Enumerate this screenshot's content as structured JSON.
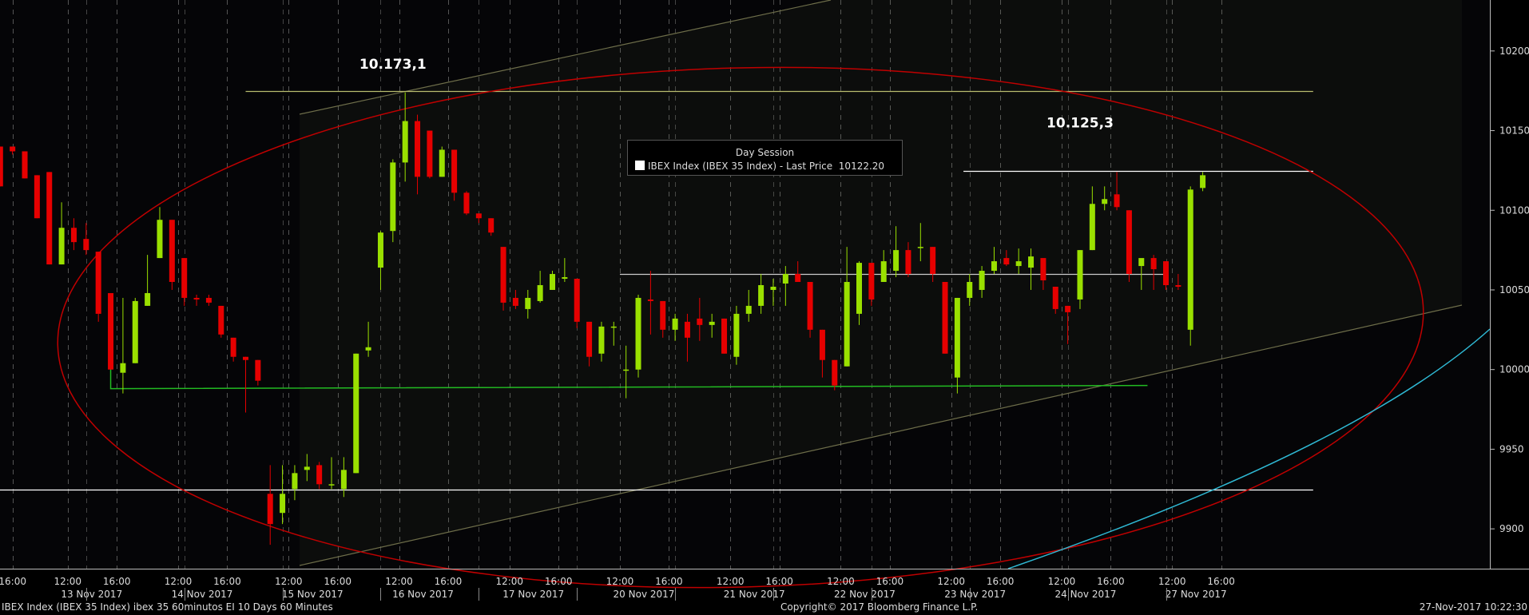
{
  "chart_data": {
    "type": "candlestick",
    "title": "IBEX Index (IBEX 35 Index) ibex 35 60minutos EI 10 Days 60 Minutes",
    "legend": {
      "title": "Day Session",
      "entry": "IBEX Index (IBEX 35 Index) - Last Price",
      "value": "10122.20"
    },
    "y_ticks": [
      9900,
      9950,
      10000,
      10050,
      10100,
      10150,
      10200
    ],
    "ylim": [
      9875,
      10232
    ],
    "candles": [
      {
        "o": 10140,
        "h": 10140,
        "l": 10115,
        "c": 10115
      },
      {
        "o": 10140,
        "h": 10140,
        "l": 10135,
        "c": 10137
      },
      {
        "o": 10137,
        "h": 10137,
        "l": 10120,
        "c": 10120
      },
      {
        "o": 10122,
        "h": 10122,
        "l": 10095,
        "c": 10095
      },
      {
        "o": 10124,
        "h": 10124,
        "l": 10066,
        "c": 10066
      },
      {
        "o": 10066,
        "h": 10105,
        "l": 10066,
        "c": 10089
      },
      {
        "o": 10089,
        "h": 10095,
        "l": 10075,
        "c": 10080
      },
      {
        "o": 10082,
        "h": 10092,
        "l": 10072,
        "c": 10075
      },
      {
        "o": 10074,
        "h": 10074,
        "l": 10030,
        "c": 10035
      },
      {
        "o": 10048,
        "h": 10048,
        "l": 10000,
        "c": 10000
      },
      {
        "o": 9998,
        "h": 10045,
        "l": 9985,
        "c": 10004
      },
      {
        "o": 10004,
        "h": 10045,
        "l": 10004,
        "c": 10043
      },
      {
        "o": 10040,
        "h": 10072,
        "l": 10040,
        "c": 10048
      },
      {
        "o": 10070,
        "h": 10102,
        "l": 10070,
        "c": 10094
      },
      {
        "o": 10094,
        "h": 10094,
        "l": 10050,
        "c": 10055
      },
      {
        "o": 10070,
        "h": 10070,
        "l": 10040,
        "c": 10045
      },
      {
        "o": 10045,
        "h": 10047,
        "l": 10040,
        "c": 10044
      },
      {
        "o": 10045,
        "h": 10047,
        "l": 10040,
        "c": 10042
      },
      {
        "o": 10040,
        "h": 10040,
        "l": 10020,
        "c": 10022
      },
      {
        "o": 10020,
        "h": 10020,
        "l": 10005,
        "c": 10008
      },
      {
        "o": 10008,
        "h": 10008,
        "l": 9973,
        "c": 10006
      },
      {
        "o": 10006,
        "h": 10006,
        "l": 9990,
        "c": 9993
      },
      {
        "o": 9922,
        "h": 9940,
        "l": 9890,
        "c": 9903
      },
      {
        "o": 9910,
        "h": 9940,
        "l": 9903,
        "c": 9922
      },
      {
        "o": 9925,
        "h": 9940,
        "l": 9918,
        "c": 9935
      },
      {
        "o": 9937,
        "h": 9947,
        "l": 9930,
        "c": 9939
      },
      {
        "o": 9940,
        "h": 9942,
        "l": 9925,
        "c": 9928
      },
      {
        "o": 9928,
        "h": 9945,
        "l": 9925,
        "c": 9928
      },
      {
        "o": 9925,
        "h": 9945,
        "l": 9920,
        "c": 9937
      },
      {
        "o": 9935,
        "h": 10010,
        "l": 9935,
        "c": 10010
      },
      {
        "o": 10012,
        "h": 10030,
        "l": 10008,
        "c": 10014
      },
      {
        "o": 10064,
        "h": 10087,
        "l": 10050,
        "c": 10086
      },
      {
        "o": 10087,
        "h": 10132,
        "l": 10080,
        "c": 10130
      },
      {
        "o": 10130,
        "h": 10174,
        "l": 10118,
        "c": 10156
      },
      {
        "o": 10156,
        "h": 10160,
        "l": 10110,
        "c": 10121
      },
      {
        "o": 10150,
        "h": 10150,
        "l": 10120,
        "c": 10121
      },
      {
        "o": 10121,
        "h": 10140,
        "l": 10121,
        "c": 10138
      },
      {
        "o": 10138,
        "h": 10138,
        "l": 10106,
        "c": 10111
      },
      {
        "o": 10111,
        "h": 10112,
        "l": 10097,
        "c": 10098
      },
      {
        "o": 10098,
        "h": 10098,
        "l": 10092,
        "c": 10095
      },
      {
        "o": 10095,
        "h": 10095,
        "l": 10084,
        "c": 10086
      },
      {
        "o": 10077,
        "h": 10077,
        "l": 10037,
        "c": 10042
      },
      {
        "o": 10045,
        "h": 10050,
        "l": 10038,
        "c": 10040
      },
      {
        "o": 10038,
        "h": 10050,
        "l": 10032,
        "c": 10045
      },
      {
        "o": 10043,
        "h": 10062,
        "l": 10042,
        "c": 10053
      },
      {
        "o": 10050,
        "h": 10062,
        "l": 10050,
        "c": 10060
      },
      {
        "o": 10057,
        "h": 10070,
        "l": 10055,
        "c": 10058
      },
      {
        "o": 10057,
        "h": 10057,
        "l": 10026,
        "c": 10030
      },
      {
        "o": 10030,
        "h": 10030,
        "l": 10002,
        "c": 10008
      },
      {
        "o": 10010,
        "h": 10030,
        "l": 10005,
        "c": 10027
      },
      {
        "o": 10027,
        "h": 10030,
        "l": 10015,
        "c": 10027
      },
      {
        "o": 10000,
        "h": 10015,
        "l": 9982,
        "c": 10000
      },
      {
        "o": 10000,
        "h": 10047,
        "l": 9995,
        "c": 10045
      },
      {
        "o": 10044,
        "h": 10062,
        "l": 10022,
        "c": 10043
      },
      {
        "o": 10043,
        "h": 10043,
        "l": 10020,
        "c": 10025
      },
      {
        "o": 10025,
        "h": 10035,
        "l": 10018,
        "c": 10032
      },
      {
        "o": 10030,
        "h": 10035,
        "l": 10005,
        "c": 10020
      },
      {
        "o": 10032,
        "h": 10045,
        "l": 10018,
        "c": 10028
      },
      {
        "o": 10028,
        "h": 10035,
        "l": 10020,
        "c": 10030
      },
      {
        "o": 10032,
        "h": 10032,
        "l": 10010,
        "c": 10010
      },
      {
        "o": 10008,
        "h": 10040,
        "l": 10003,
        "c": 10035
      },
      {
        "o": 10035,
        "h": 10050,
        "l": 10030,
        "c": 10040
      },
      {
        "o": 10040,
        "h": 10060,
        "l": 10035,
        "c": 10053
      },
      {
        "o": 10050,
        "h": 10057,
        "l": 10040,
        "c": 10052
      },
      {
        "o": 10054,
        "h": 10065,
        "l": 10040,
        "c": 10060
      },
      {
        "o": 10060,
        "h": 10068,
        "l": 10055,
        "c": 10055
      },
      {
        "o": 10055,
        "h": 10055,
        "l": 10020,
        "c": 10025
      },
      {
        "o": 10025,
        "h": 10025,
        "l": 9995,
        "c": 10006
      },
      {
        "o": 10006,
        "h": 10006,
        "l": 9987,
        "c": 9990
      },
      {
        "o": 10002,
        "h": 10077,
        "l": 10002,
        "c": 10055
      },
      {
        "o": 10035,
        "h": 10068,
        "l": 10028,
        "c": 10067
      },
      {
        "o": 10067,
        "h": 10067,
        "l": 10040,
        "c": 10044
      },
      {
        "o": 10055,
        "h": 10075,
        "l": 10055,
        "c": 10068
      },
      {
        "o": 10062,
        "h": 10090,
        "l": 10058,
        "c": 10075
      },
      {
        "o": 10075,
        "h": 10080,
        "l": 10058,
        "c": 10060
      },
      {
        "o": 10077,
        "h": 10092,
        "l": 10068,
        "c": 10077
      },
      {
        "o": 10077,
        "h": 10077,
        "l": 10055,
        "c": 10060
      },
      {
        "o": 10055,
        "h": 10055,
        "l": 10010,
        "c": 10010
      },
      {
        "o": 9995,
        "h": 10045,
        "l": 9985,
        "c": 10045
      },
      {
        "o": 10045,
        "h": 10060,
        "l": 10040,
        "c": 10055
      },
      {
        "o": 10050,
        "h": 10065,
        "l": 10045,
        "c": 10062
      },
      {
        "o": 10062,
        "h": 10077,
        "l": 10060,
        "c": 10068
      },
      {
        "o": 10070,
        "h": 10075,
        "l": 10065,
        "c": 10066
      },
      {
        "o": 10065,
        "h": 10076,
        "l": 10060,
        "c": 10068
      },
      {
        "o": 10064,
        "h": 10076,
        "l": 10050,
        "c": 10071
      },
      {
        "o": 10070,
        "h": 10070,
        "l": 10050,
        "c": 10056
      },
      {
        "o": 10052,
        "h": 10052,
        "l": 10035,
        "c": 10038
      },
      {
        "o": 10040,
        "h": 10040,
        "l": 10016,
        "c": 10036
      },
      {
        "o": 10044,
        "h": 10075,
        "l": 10038,
        "c": 10075
      },
      {
        "o": 10075,
        "h": 10115,
        "l": 10075,
        "c": 10104
      },
      {
        "o": 10104,
        "h": 10115,
        "l": 10100,
        "c": 10107
      },
      {
        "o": 10110,
        "h": 10124,
        "l": 10100,
        "c": 10102
      },
      {
        "o": 10100,
        "h": 10100,
        "l": 10055,
        "c": 10060
      },
      {
        "o": 10065,
        "h": 10065,
        "l": 10050,
        "c": 10070
      },
      {
        "o": 10070,
        "h": 10072,
        "l": 10050,
        "c": 10063
      },
      {
        "o": 10068,
        "h": 10068,
        "l": 10050,
        "c": 10053
      },
      {
        "o": 10053,
        "h": 10060,
        "l": 10050,
        "c": 10052
      },
      {
        "o": 10025,
        "h": 10115,
        "l": 10015,
        "c": 10113
      },
      {
        "o": 10114,
        "h": 10124,
        "l": 10112,
        "c": 10122
      }
    ],
    "x_labels": [
      {
        "candle": 1,
        "time": "16:00",
        "date": ""
      },
      {
        "candle": 5.5,
        "time": "12:00",
        "date": "13 Nov 2017"
      },
      {
        "candle": 9.5,
        "time": "16:00",
        "date": ""
      },
      {
        "candle": 14.5,
        "time": "12:00",
        "date": "14 Nov 2017"
      },
      {
        "candle": 18.5,
        "time": "16:00",
        "date": ""
      },
      {
        "candle": 23.5,
        "time": "12:00",
        "date": "15 Nov 2017"
      },
      {
        "candle": 27.5,
        "time": "16:00",
        "date": ""
      },
      {
        "candle": 32.5,
        "time": "12:00",
        "date": "16 Nov 2017"
      },
      {
        "candle": 36.5,
        "time": "16:00",
        "date": ""
      },
      {
        "candle": 41.5,
        "time": "12:00",
        "date": "17 Nov 2017"
      },
      {
        "candle": 45.5,
        "time": "16:00",
        "date": ""
      },
      {
        "candle": 50.5,
        "time": "12:00",
        "date": "20 Nov 2017"
      },
      {
        "candle": 54.5,
        "time": "16:00",
        "date": ""
      },
      {
        "candle": 59.5,
        "time": "12:00",
        "date": "21 Nov 2017"
      },
      {
        "candle": 63.5,
        "time": "16:00",
        "date": ""
      },
      {
        "candle": 68.5,
        "time": "12:00",
        "date": "22 Nov 2017"
      },
      {
        "candle": 72.5,
        "time": "16:00",
        "date": ""
      },
      {
        "candle": 77.5,
        "time": "12:00",
        "date": "23 Nov 2017"
      },
      {
        "candle": 81.5,
        "time": "16:00",
        "date": ""
      },
      {
        "candle": 86.5,
        "time": "12:00",
        "date": "24 Nov 2017"
      },
      {
        "candle": 90.5,
        "time": "16:00",
        "date": ""
      },
      {
        "candle": 95.5,
        "time": "12:00",
        "date": "27 Nov 2017"
      },
      {
        "candle": 99.5,
        "time": "16:00",
        "date": ""
      }
    ],
    "annotations": [
      {
        "text": "10.173,1",
        "candle": 32,
        "price": 10189
      },
      {
        "text": "10.125,3",
        "candle": 88,
        "price": 10152
      }
    ],
    "levels": [
      {
        "price": 10175,
        "color": "#b8bc6e",
        "from": 20,
        "to": 107
      },
      {
        "price": 10124.5,
        "color": "#ffffff",
        "from": 78.5,
        "to": 107
      },
      {
        "price": 10060,
        "color": "#cccccc",
        "from": 50.5,
        "to": 95
      },
      {
        "price": 9924.5,
        "color": "#ffffff",
        "from": -1,
        "to": 107
      }
    ],
    "colors": {
      "up": "#9ae000",
      "down": "#e60000",
      "ellipse": "#c00000",
      "support": "#22bb22",
      "ma": "#2fb9d4"
    },
    "footer": {
      "left": "IBEX Index (IBEX 35 Index) ibex 35 60minutos EI 10 Days 60 Minutes",
      "center": "Copyright© 2017 Bloomberg Finance L.P.",
      "right": "27-Nov-2017 10:22:30"
    }
  }
}
